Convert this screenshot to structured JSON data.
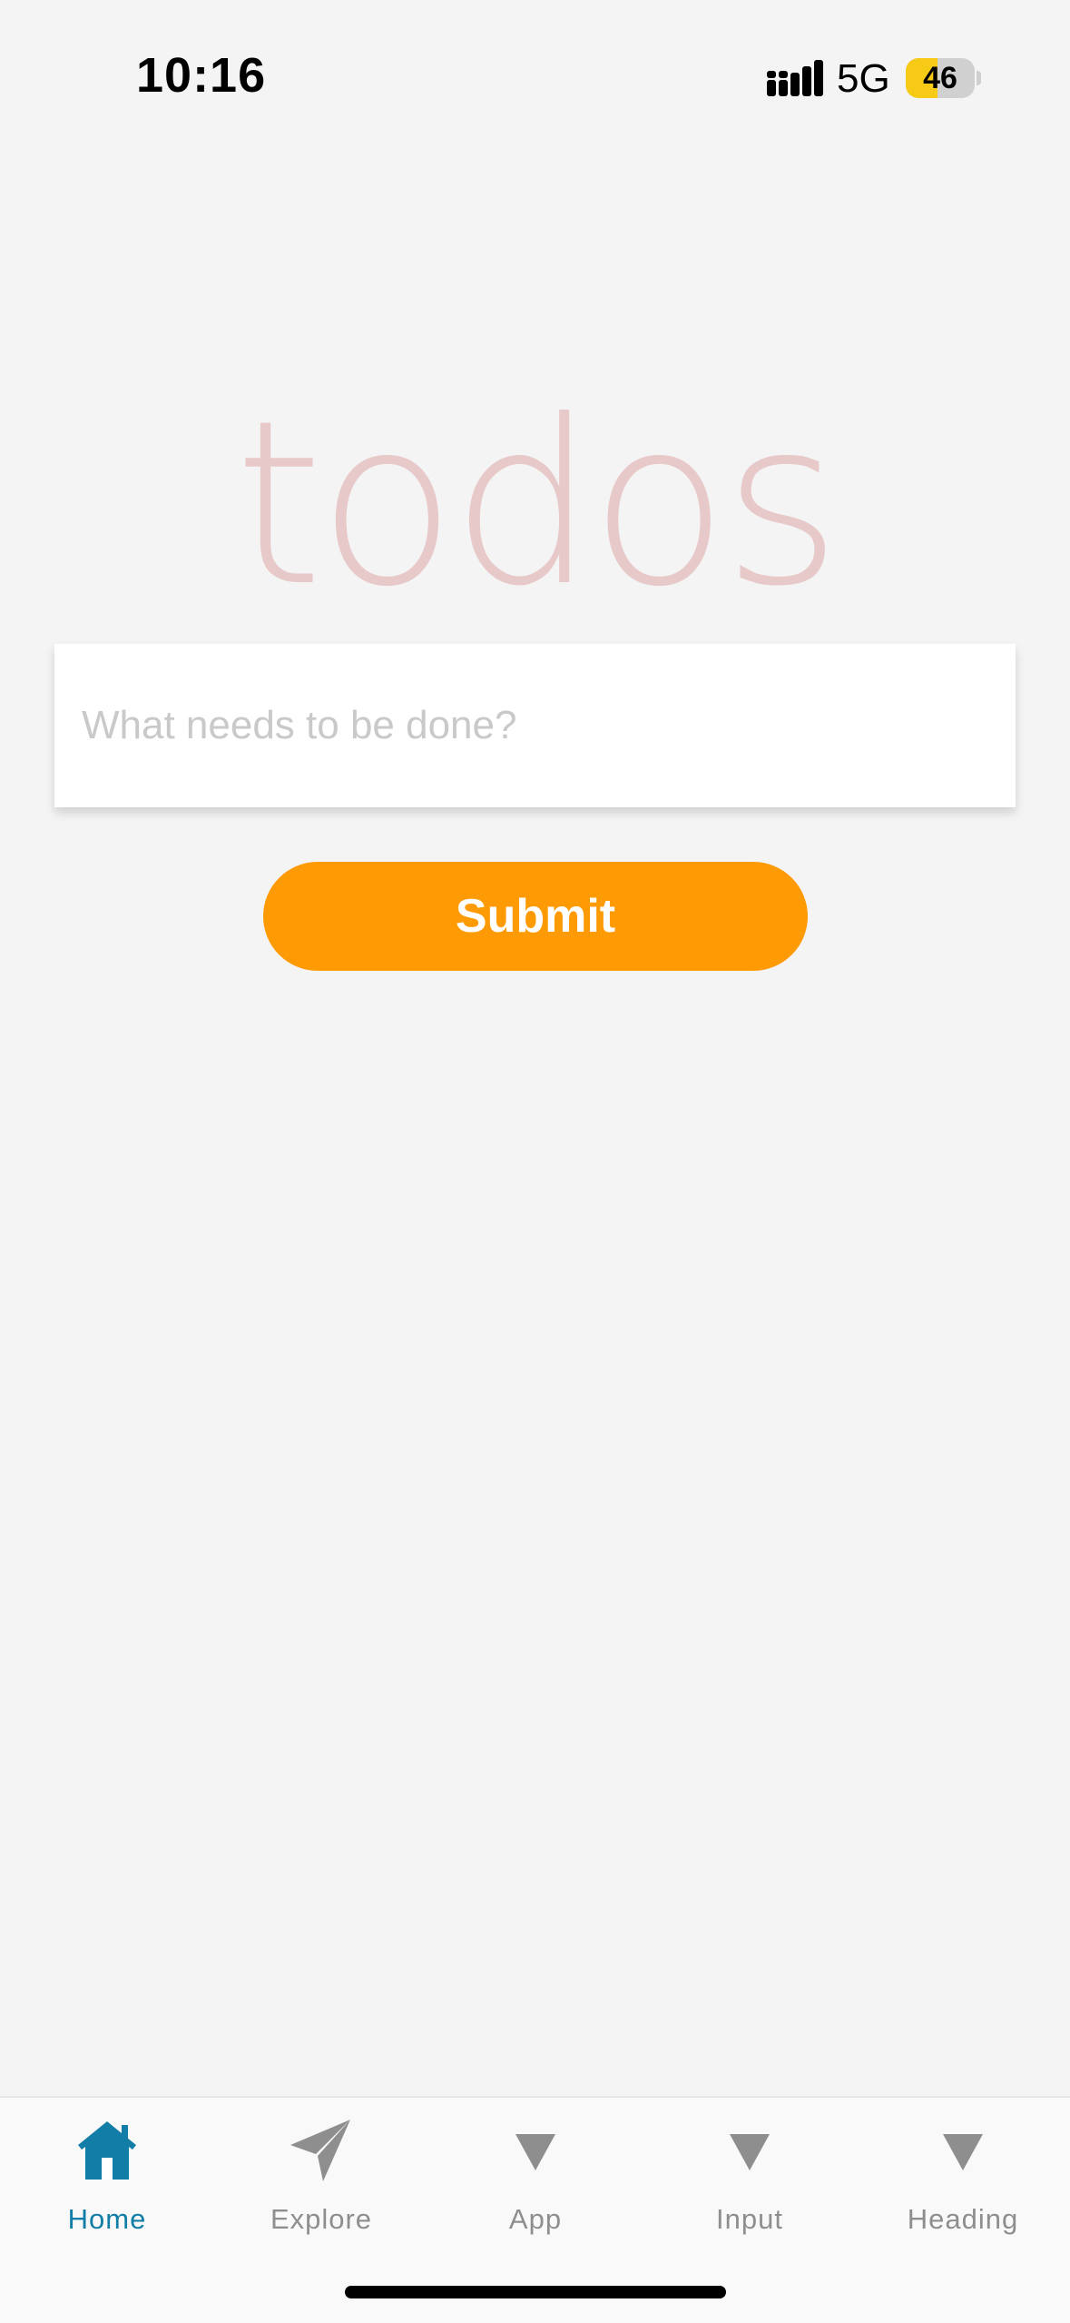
{
  "status_bar": {
    "time": "10:16",
    "network": "5G",
    "battery_level": "46",
    "battery_fraction": 0.46
  },
  "main": {
    "title": "todos",
    "input_placeholder": "What needs to be done?",
    "input_value": "",
    "submit_label": "Submit"
  },
  "tab_bar": {
    "tabs": [
      {
        "label": "Home",
        "icon": "house-icon",
        "active": true
      },
      {
        "label": "Explore",
        "icon": "paper-plane-icon",
        "active": false
      },
      {
        "label": "App",
        "icon": "triangle-down-icon",
        "active": false
      },
      {
        "label": "Input",
        "icon": "triangle-down-icon",
        "active": false
      },
      {
        "label": "Heading",
        "icon": "triangle-down-icon",
        "active": false
      }
    ]
  },
  "colors": {
    "background": "#f4f4f4",
    "title": "#e8c9c9",
    "accent_button": "#fe9a03",
    "active_tab": "#127da7",
    "inactive_tab": "#8e8e8e",
    "battery": "#f7cb15"
  }
}
